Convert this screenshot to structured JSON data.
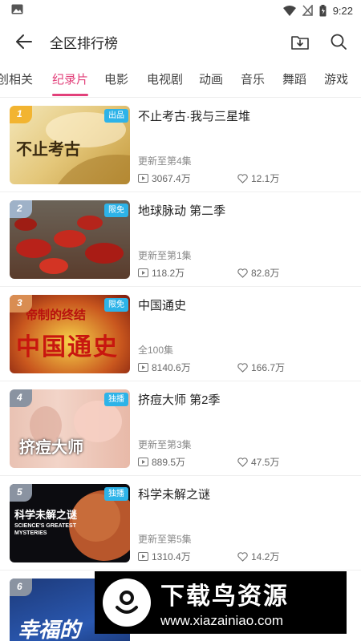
{
  "status_bar": {
    "time": "9:22"
  },
  "header": {
    "title": "全区排行榜"
  },
  "tabs": [
    {
      "label": "创相关"
    },
    {
      "label": "纪录片"
    },
    {
      "label": "电影"
    },
    {
      "label": "电视剧"
    },
    {
      "label": "动画"
    },
    {
      "label": "音乐"
    },
    {
      "label": "舞蹈"
    },
    {
      "label": "游戏"
    }
  ],
  "active_tab": "纪录片",
  "items": [
    {
      "rank": "1",
      "badge": "出品",
      "title": "不止考古·我与三星堆",
      "update": "更新至第4集",
      "plays": "3067.4万",
      "likes": "12.1万",
      "thumb_text": "不止考古",
      "rank_color": "#f2b431"
    },
    {
      "rank": "2",
      "badge": "限免",
      "title": "地球脉动 第二季",
      "update": "更新至第1集",
      "plays": "118.2万",
      "likes": "82.8万",
      "thumb_text": "",
      "rank_color": "#9fb2c8"
    },
    {
      "rank": "3",
      "badge": "限免",
      "title": "中国通史",
      "update": "全100集",
      "plays": "8140.6万",
      "likes": "166.7万",
      "thumb_text": "中国通史",
      "thumb_subtext": "帝制的终结",
      "rank_color": "#d98d52"
    },
    {
      "rank": "4",
      "badge": "独播",
      "title": "挤痘大师 第2季",
      "update": "更新至第3集",
      "plays": "889.5万",
      "likes": "47.5万",
      "thumb_text": "挤痘大师",
      "rank_color": "#8a93a1"
    },
    {
      "rank": "5",
      "badge": "独播",
      "title": "科学未解之谜",
      "update": "更新至第5集",
      "plays": "1310.4万",
      "likes": "14.2万",
      "thumb_text": "科学未解之谜",
      "thumb_subtext": "SCIENCE'S GREATEST MYSTERIES",
      "rank_color": "#8a93a1"
    },
    {
      "rank": "6",
      "badge": "",
      "title": "",
      "update": "",
      "plays": "",
      "likes": "",
      "thumb_text": "幸福的",
      "rank_color": "#8a93a1"
    }
  ],
  "watermark": {
    "title": "下载鸟资源",
    "url": "www.xiazainiao.com"
  },
  "colors": {
    "accent": "#e2407a",
    "badge": "#2db3e8"
  }
}
